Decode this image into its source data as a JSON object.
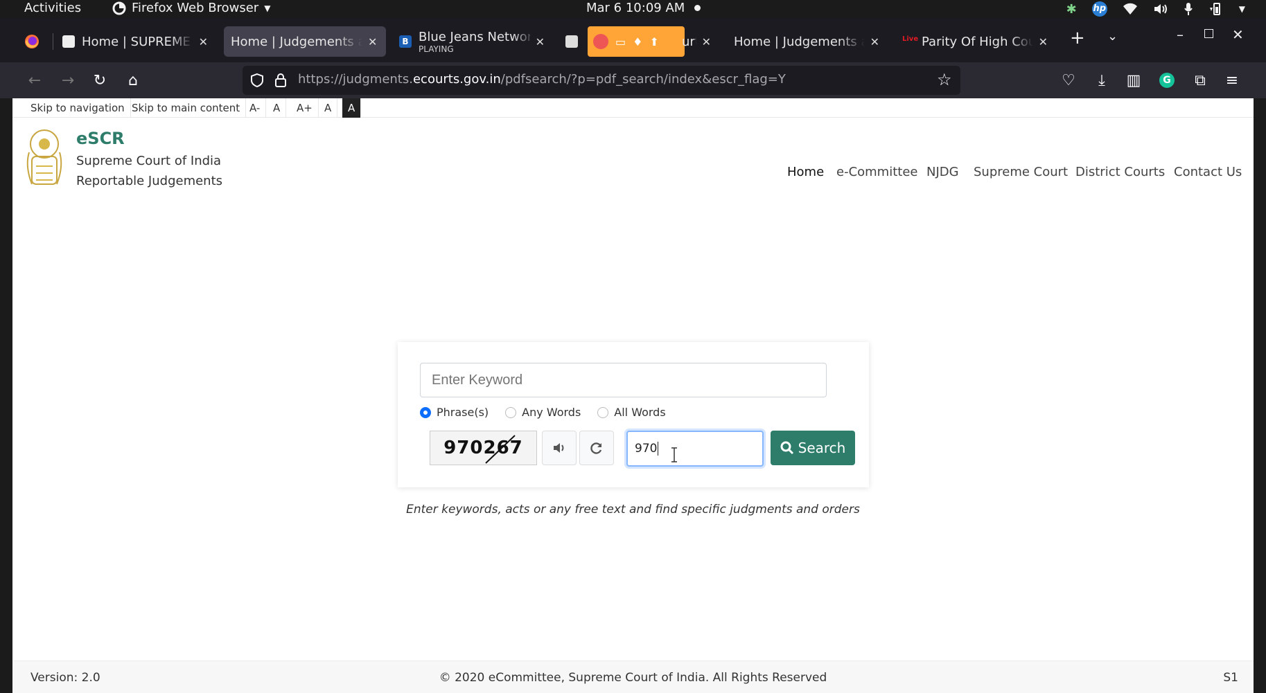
{
  "system": {
    "activities": "Activities",
    "app_name": "Firefox Web Browser",
    "clock": "Mar 6  10:09 AM"
  },
  "tabs": [
    {
      "title": "Home | SUPREME C",
      "active": false
    },
    {
      "title": "Home | Judgements a",
      "active": true
    },
    {
      "title": "Blue Jeans Networ",
      "subtitle": "PLAYING",
      "active": false
    },
    {
      "title": "urt",
      "active": false
    },
    {
      "title": "Home | Judgements a",
      "active": false
    },
    {
      "title": "Parity Of High Cou",
      "active": false
    }
  ],
  "urlbar": {
    "prefix": "https://judgments.",
    "host": "ecourts.gov.in",
    "path": "/pdfsearch/?p=pdf_search/index&escr_flag=Y"
  },
  "a11y": [
    "Skip to navigation",
    "Skip to main content",
    "A-",
    "A",
    "A+",
    "A",
    "A"
  ],
  "brand": {
    "title": "eSCR",
    "subtitle1": "Supreme Court of India",
    "subtitle2": "Reportable Judgements"
  },
  "nav": [
    "Home",
    "e-Committee",
    "NJDG",
    "Supreme Court",
    "District Courts",
    "Contact Us"
  ],
  "search": {
    "keyword_placeholder": "Enter Keyword",
    "options": [
      "Phrase(s)",
      "Any Words",
      "All Words"
    ],
    "selected_option": "Phrase(s)",
    "captcha_text": "970267",
    "captcha_value": "970",
    "button_label": "Search"
  },
  "hint": "Enter keywords, acts or any free text and find specific judgments and orders",
  "footer": {
    "version": "Version: 2.0",
    "copyright": "© 2020 eCommittee, Supreme Court of India. All Rights Reserved",
    "server": "S1"
  },
  "colors": {
    "brand_green": "#2e7d6b",
    "focus_blue": "#86b7fe",
    "radio_blue": "#0d6efd"
  }
}
